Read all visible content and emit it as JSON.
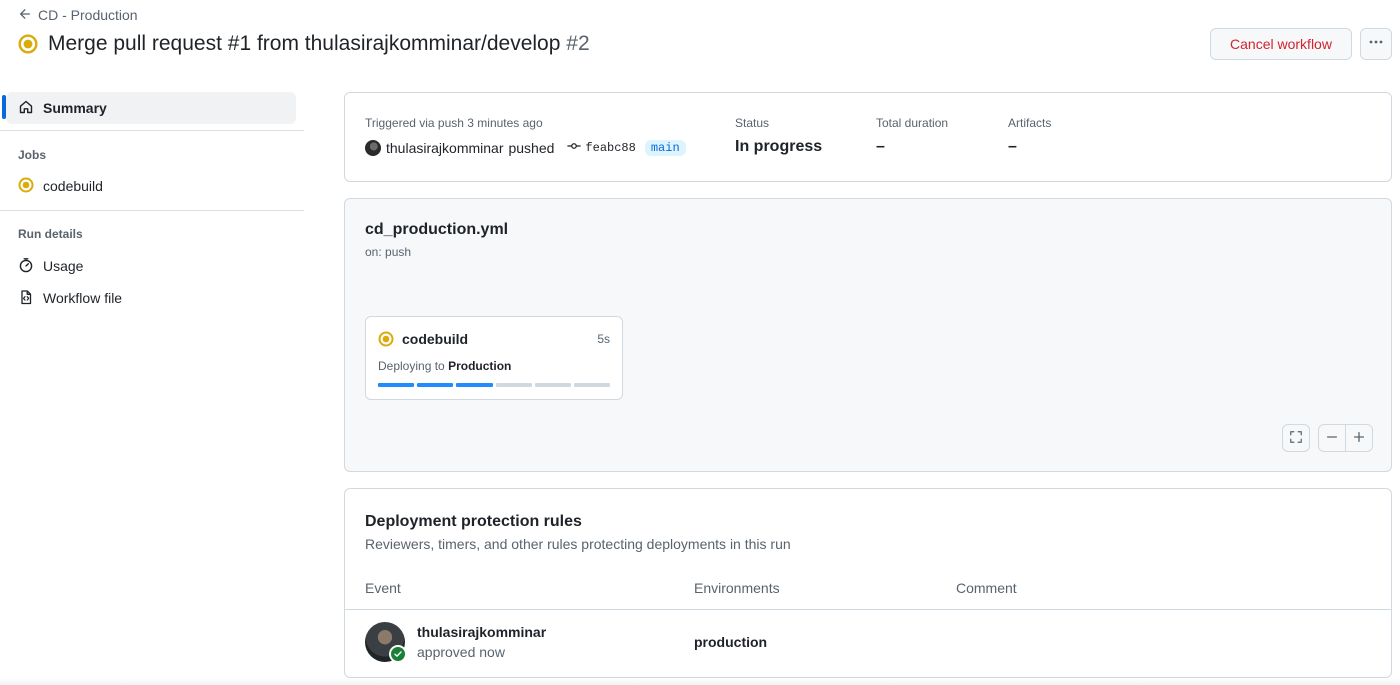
{
  "header": {
    "back_label": "CD - Production",
    "title": "Merge pull request #1 from thulasirajkomminar/develop",
    "run_number": "#2",
    "cancel_label": "Cancel workflow",
    "more_icon": "kebab-horizontal-icon"
  },
  "sidebar": {
    "summary_label": "Summary",
    "jobs_heading": "Jobs",
    "job_label": "codebuild",
    "run_details_heading": "Run details",
    "usage_label": "Usage",
    "workflow_file_label": "Workflow file"
  },
  "summary": {
    "triggered_label": "Triggered via push 3 minutes ago",
    "actor": "thulasirajkomminar",
    "action": "pushed",
    "commit": "feabc88",
    "branch": "main",
    "status_label": "Status",
    "status_value": "In progress",
    "duration_label": "Total duration",
    "duration_value": "–",
    "artifacts_label": "Artifacts",
    "artifacts_value": "–"
  },
  "graph": {
    "workflow_file": "cd_production.yml",
    "trigger": "on: push",
    "job": {
      "name": "codebuild",
      "elapsed": "5s",
      "step_prefix": "Deploying to",
      "step_env": "Production",
      "steps_total": 6,
      "steps_done": 3
    }
  },
  "rules": {
    "title": "Deployment protection rules",
    "subtitle": "Reviewers, timers, and other rules protecting deployments in this run",
    "columns": [
      "Event",
      "Environments",
      "Comment"
    ],
    "row": {
      "user": "thulasirajkomminar",
      "event": "approved now",
      "environment": "production",
      "comment": ""
    }
  },
  "colors": {
    "in_progress": "#dbab0a",
    "accent": "#0969da",
    "danger": "#d1242f",
    "success": "#1a7f37",
    "progress_fill": "#218bff"
  }
}
